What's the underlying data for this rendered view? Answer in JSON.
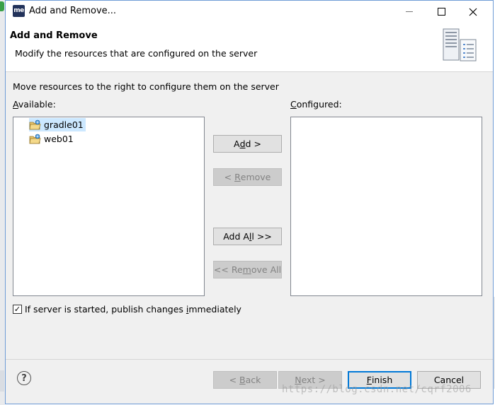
{
  "window": {
    "app_icon_text": "me",
    "title": "Add and Remove..."
  },
  "header": {
    "title": "Add and Remove",
    "description": "Modify the resources that are configured on the server"
  },
  "instruction": "Move resources to the right to configure them on the server",
  "available": {
    "label_accel": "A",
    "label_rest": "vailable:",
    "items": [
      {
        "label": "gradle01",
        "selected": true
      },
      {
        "label": "web01",
        "selected": false
      }
    ]
  },
  "configured": {
    "label_accel": "C",
    "label_rest": "onfigured:",
    "items": []
  },
  "buttons": {
    "add": {
      "pre": "A",
      "accel": "d",
      "post": "d >"
    },
    "remove": {
      "pre": "< ",
      "accel": "R",
      "post": "emove"
    },
    "add_all": {
      "pre": "Add A",
      "accel": "l",
      "post": "l >>"
    },
    "remove_all": {
      "pre": "<< Re",
      "accel": "m",
      "post": "ove All"
    },
    "back": {
      "pre": "< ",
      "accel": "B",
      "post": "ack"
    },
    "next": {
      "pre": "",
      "accel": "N",
      "post": "ext >"
    },
    "finish": {
      "pre": "",
      "accel": "F",
      "post": "inish"
    },
    "cancel": "Cancel"
  },
  "publish_option": {
    "checked": true,
    "check_glyph": "✓",
    "pre": "If server is started, publish changes ",
    "accel": "i",
    "post": "mmediately"
  },
  "help_glyph": "?",
  "watermark": "https://blog.csdn.net/cqrf2006",
  "colors": {
    "selection": "#cce8ff",
    "default_button_border": "#0078d7",
    "frame": "#6f9cd6"
  }
}
